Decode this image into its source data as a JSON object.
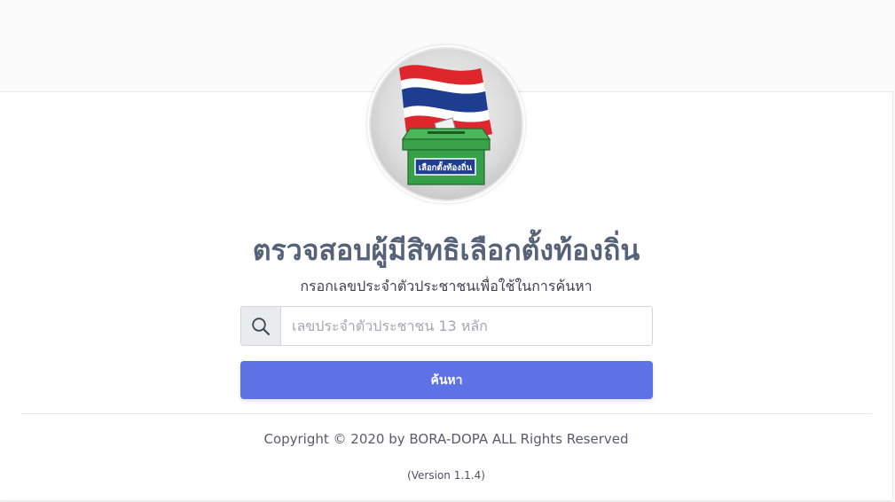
{
  "logo": {
    "ballot_box_label": "เลือกตั้งท้องถิ่น",
    "colors": {
      "flag_red": "#e0262d",
      "flag_white": "#ffffff",
      "flag_blue": "#1d3d8e",
      "box_green": "#3aa34a",
      "label_blue": "#1f3e8f"
    }
  },
  "header": {
    "title": "ตรวจสอบผู้มีสิทธิเลือกตั้งท้องถิ่น",
    "subtitle": "กรอกเลขประจำตัวประชาชนเพื่อใช้ในการค้นหา"
  },
  "search": {
    "icon": "search-icon",
    "value": "",
    "placeholder": "เลขประจำตัวประชาชน 13 หลัก",
    "button_label": "ค้นหา",
    "accent_color": "#5d72e4"
  },
  "footer": {
    "copyright": "Copyright © 2020 by BORA-DOPA ALL Rights Reserved",
    "version": "(Version 1.1.4)"
  }
}
